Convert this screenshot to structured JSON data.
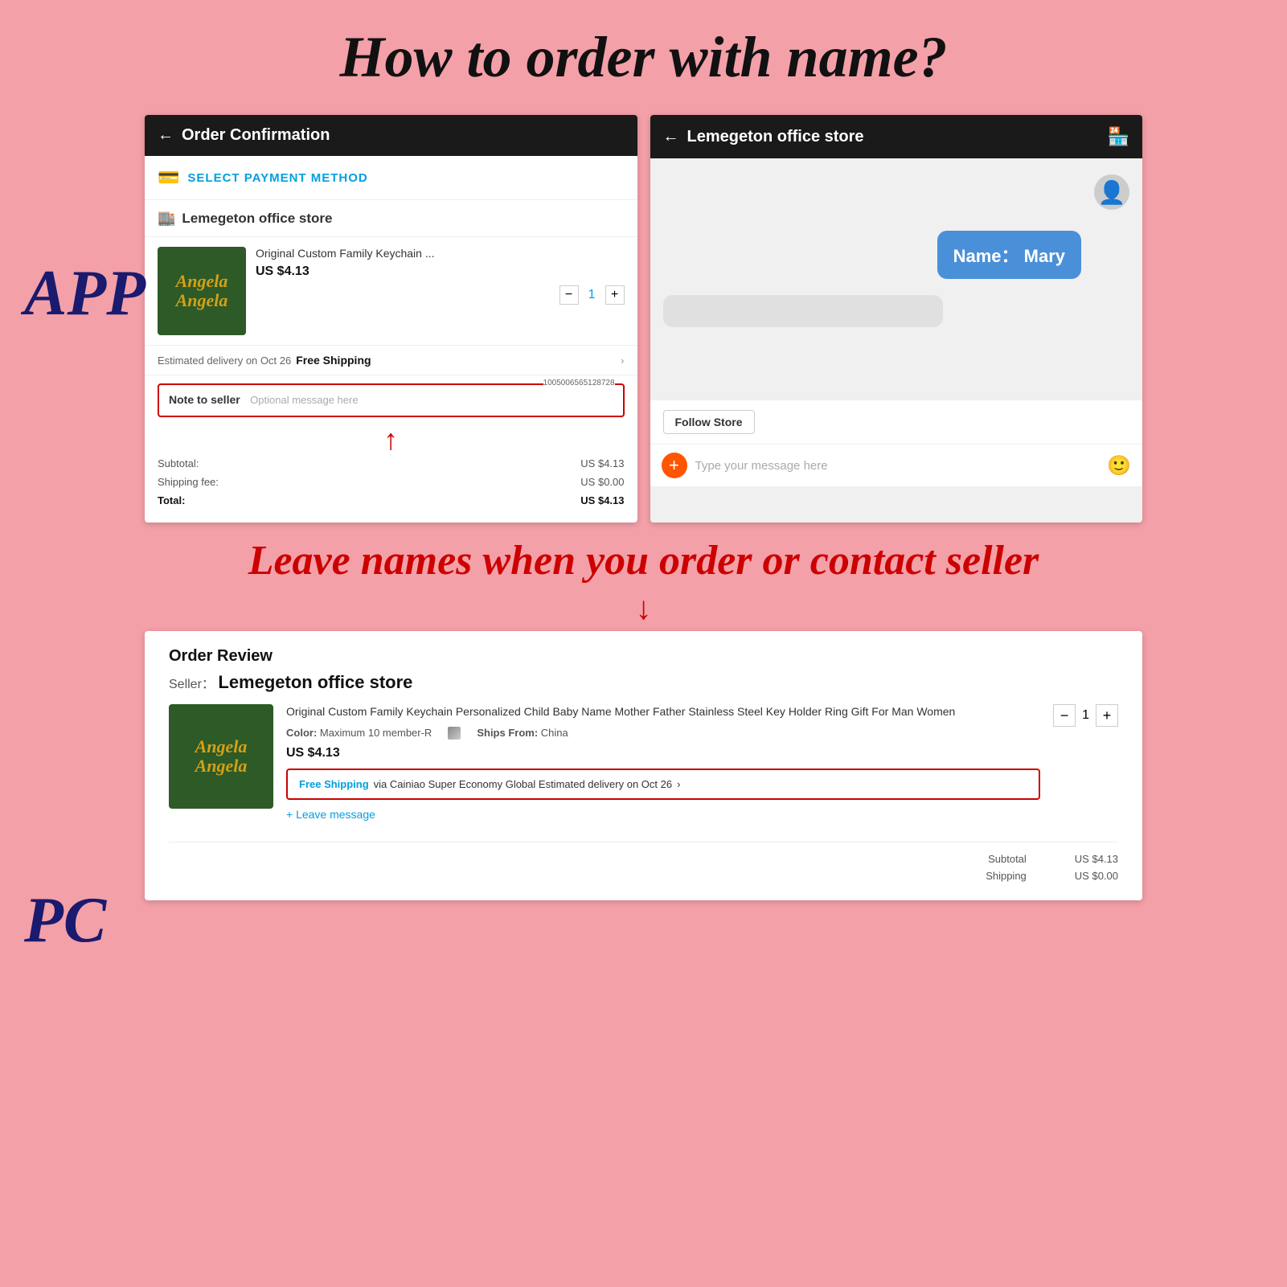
{
  "page": {
    "main_title": "How to order with name?",
    "app_label": "APP",
    "pc_label": "PC",
    "callout_text": "Leave names when you order or contact seller"
  },
  "app_left": {
    "header": {
      "back_label": "←",
      "title": "Order Confirmation"
    },
    "payment": {
      "label": "SELECT PAYMENT METHOD"
    },
    "store": {
      "name": "Lemegeton office store"
    },
    "product": {
      "name": "Original Custom Family Keychain ...",
      "price": "US $4.13",
      "quantity": "1"
    },
    "delivery": {
      "text": "Estimated delivery on Oct 26",
      "shipping": "Free Shipping"
    },
    "note": {
      "label": "Note to seller",
      "placeholder": "Optional message here",
      "id": "1005006565128728"
    },
    "summary": {
      "subtotal_label": "Subtotal:",
      "subtotal_value": "US $4.13",
      "shipping_label": "Shipping fee:",
      "shipping_value": "US $0.00",
      "total_label": "Total:",
      "total_value": "US $4.13"
    }
  },
  "app_right": {
    "header": {
      "back_label": "←",
      "title": "Lemegeton office store"
    },
    "chat": {
      "name_bubble": "Name：  Mary",
      "follow_store": "Follow Store",
      "input_placeholder": "Type your message here"
    }
  },
  "pc": {
    "order_review_title": "Order Review",
    "seller_label": "Seller：",
    "seller_name": "Lemegeton office store",
    "product": {
      "name": "Original Custom Family Keychain Personalized Child Baby Name Mother Father Stainless Steel Key Holder Ring Gift For Man Women",
      "color_label": "Color:",
      "color_value": "Maximum 10 member-R",
      "ships_label": "Ships From:",
      "ships_value": "China",
      "price": "US $4.13",
      "quantity": "1"
    },
    "shipping": {
      "text": "Free Shipping via Cainiao Super Economy Global  Estimated delivery on Oct 26",
      "arrow": ">"
    },
    "leave_message": "+ Leave message",
    "summary": {
      "subtotal_label": "Subtotal",
      "subtotal_value": "US $4.13",
      "shipping_label": "Shipping",
      "shipping_value": "US $0.00"
    }
  },
  "icons": {
    "back": "←",
    "shop": "🏪",
    "payment": "💳",
    "store": "🏬",
    "plus": "+",
    "minus": "−",
    "smile": "🙂",
    "person": "👤",
    "arrow_right": ">",
    "red_arrow_up": "↑",
    "red_arrow_down": "↓"
  }
}
